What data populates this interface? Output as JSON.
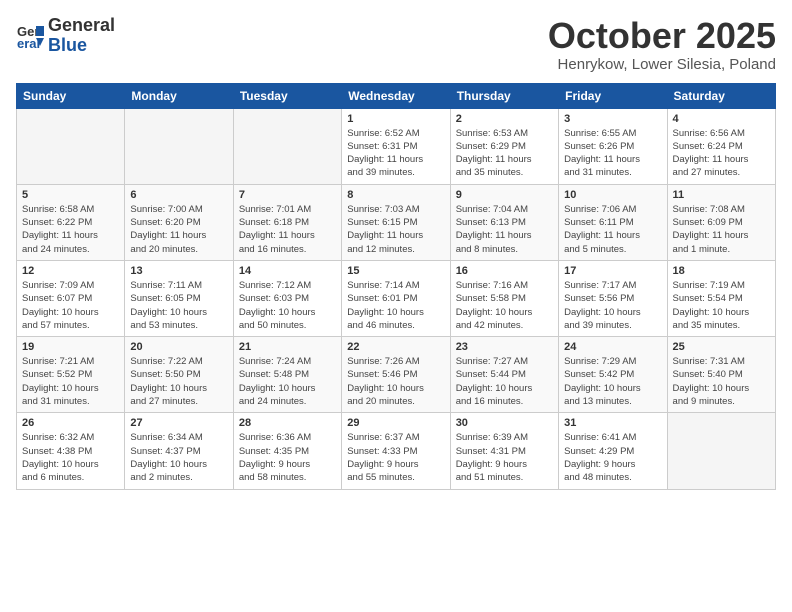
{
  "header": {
    "logo_general": "General",
    "logo_blue": "Blue",
    "month_title": "October 2025",
    "location": "Henrykow, Lower Silesia, Poland"
  },
  "days_of_week": [
    "Sunday",
    "Monday",
    "Tuesday",
    "Wednesday",
    "Thursday",
    "Friday",
    "Saturday"
  ],
  "weeks": [
    [
      {
        "day": "",
        "info": ""
      },
      {
        "day": "",
        "info": ""
      },
      {
        "day": "",
        "info": ""
      },
      {
        "day": "1",
        "info": "Sunrise: 6:52 AM\nSunset: 6:31 PM\nDaylight: 11 hours\nand 39 minutes."
      },
      {
        "day": "2",
        "info": "Sunrise: 6:53 AM\nSunset: 6:29 PM\nDaylight: 11 hours\nand 35 minutes."
      },
      {
        "day": "3",
        "info": "Sunrise: 6:55 AM\nSunset: 6:26 PM\nDaylight: 11 hours\nand 31 minutes."
      },
      {
        "day": "4",
        "info": "Sunrise: 6:56 AM\nSunset: 6:24 PM\nDaylight: 11 hours\nand 27 minutes."
      }
    ],
    [
      {
        "day": "5",
        "info": "Sunrise: 6:58 AM\nSunset: 6:22 PM\nDaylight: 11 hours\nand 24 minutes."
      },
      {
        "day": "6",
        "info": "Sunrise: 7:00 AM\nSunset: 6:20 PM\nDaylight: 11 hours\nand 20 minutes."
      },
      {
        "day": "7",
        "info": "Sunrise: 7:01 AM\nSunset: 6:18 PM\nDaylight: 11 hours\nand 16 minutes."
      },
      {
        "day": "8",
        "info": "Sunrise: 7:03 AM\nSunset: 6:15 PM\nDaylight: 11 hours\nand 12 minutes."
      },
      {
        "day": "9",
        "info": "Sunrise: 7:04 AM\nSunset: 6:13 PM\nDaylight: 11 hours\nand 8 minutes."
      },
      {
        "day": "10",
        "info": "Sunrise: 7:06 AM\nSunset: 6:11 PM\nDaylight: 11 hours\nand 5 minutes."
      },
      {
        "day": "11",
        "info": "Sunrise: 7:08 AM\nSunset: 6:09 PM\nDaylight: 11 hours\nand 1 minute."
      }
    ],
    [
      {
        "day": "12",
        "info": "Sunrise: 7:09 AM\nSunset: 6:07 PM\nDaylight: 10 hours\nand 57 minutes."
      },
      {
        "day": "13",
        "info": "Sunrise: 7:11 AM\nSunset: 6:05 PM\nDaylight: 10 hours\nand 53 minutes."
      },
      {
        "day": "14",
        "info": "Sunrise: 7:12 AM\nSunset: 6:03 PM\nDaylight: 10 hours\nand 50 minutes."
      },
      {
        "day": "15",
        "info": "Sunrise: 7:14 AM\nSunset: 6:01 PM\nDaylight: 10 hours\nand 46 minutes."
      },
      {
        "day": "16",
        "info": "Sunrise: 7:16 AM\nSunset: 5:58 PM\nDaylight: 10 hours\nand 42 minutes."
      },
      {
        "day": "17",
        "info": "Sunrise: 7:17 AM\nSunset: 5:56 PM\nDaylight: 10 hours\nand 39 minutes."
      },
      {
        "day": "18",
        "info": "Sunrise: 7:19 AM\nSunset: 5:54 PM\nDaylight: 10 hours\nand 35 minutes."
      }
    ],
    [
      {
        "day": "19",
        "info": "Sunrise: 7:21 AM\nSunset: 5:52 PM\nDaylight: 10 hours\nand 31 minutes."
      },
      {
        "day": "20",
        "info": "Sunrise: 7:22 AM\nSunset: 5:50 PM\nDaylight: 10 hours\nand 27 minutes."
      },
      {
        "day": "21",
        "info": "Sunrise: 7:24 AM\nSunset: 5:48 PM\nDaylight: 10 hours\nand 24 minutes."
      },
      {
        "day": "22",
        "info": "Sunrise: 7:26 AM\nSunset: 5:46 PM\nDaylight: 10 hours\nand 20 minutes."
      },
      {
        "day": "23",
        "info": "Sunrise: 7:27 AM\nSunset: 5:44 PM\nDaylight: 10 hours\nand 16 minutes."
      },
      {
        "day": "24",
        "info": "Sunrise: 7:29 AM\nSunset: 5:42 PM\nDaylight: 10 hours\nand 13 minutes."
      },
      {
        "day": "25",
        "info": "Sunrise: 7:31 AM\nSunset: 5:40 PM\nDaylight: 10 hours\nand 9 minutes."
      }
    ],
    [
      {
        "day": "26",
        "info": "Sunrise: 6:32 AM\nSunset: 4:38 PM\nDaylight: 10 hours\nand 6 minutes."
      },
      {
        "day": "27",
        "info": "Sunrise: 6:34 AM\nSunset: 4:37 PM\nDaylight: 10 hours\nand 2 minutes."
      },
      {
        "day": "28",
        "info": "Sunrise: 6:36 AM\nSunset: 4:35 PM\nDaylight: 9 hours\nand 58 minutes."
      },
      {
        "day": "29",
        "info": "Sunrise: 6:37 AM\nSunset: 4:33 PM\nDaylight: 9 hours\nand 55 minutes."
      },
      {
        "day": "30",
        "info": "Sunrise: 6:39 AM\nSunset: 4:31 PM\nDaylight: 9 hours\nand 51 minutes."
      },
      {
        "day": "31",
        "info": "Sunrise: 6:41 AM\nSunset: 4:29 PM\nDaylight: 9 hours\nand 48 minutes."
      },
      {
        "day": "",
        "info": ""
      }
    ]
  ]
}
